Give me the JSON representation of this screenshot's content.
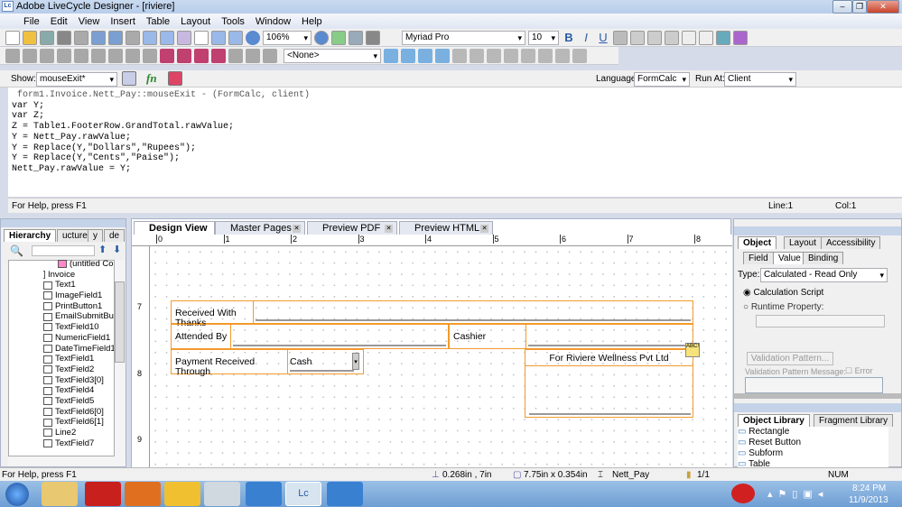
{
  "window": {
    "title": "Adobe LiveCycle Designer - [riviere]",
    "app_icon": "Lc"
  },
  "menu": [
    "File",
    "Edit",
    "View",
    "Insert",
    "Table",
    "Layout",
    "Tools",
    "Window",
    "Help"
  ],
  "toolbar1": {
    "zoom": "106%",
    "font": "Myriad Pro",
    "size": "10",
    "bold": "B",
    "italic": "I",
    "underline": "U"
  },
  "toolbar2": {
    "master_select": "<None>"
  },
  "script": {
    "show_label": "Show:",
    "event": "mouseExit*",
    "fx": "fn",
    "language_label": "Language:",
    "language": "FormCalc",
    "run_at_label": "Run At:",
    "run_at": "Client",
    "lines": [
      " form1.Invoice.Nett_Pay::mouseExit - (FormCalc, client)",
      "var Y;",
      "var Z;",
      "Z = Table1.FooterRow.GrandTotal.rawValue;",
      "Y = Nett_Pay.rawValue;",
      "Y = Replace(Y,\"Dollars\",\"Rupees\");",
      "Y = Replace(Y,\"Cents\",\"Paise\");",
      "Nett_Pay.rawValue = Y;"
    ],
    "help": "For Help, press F1",
    "line": "Line:1",
    "col": "Col:1"
  },
  "hierarchy": {
    "tabs": [
      "Hierarchy",
      "ucture",
      "y",
      "de"
    ],
    "items": [
      "(untitled Cor",
      "Invoice",
      "Text1",
      "ImageField1",
      "PrintButton1",
      "EmailSubmitButt",
      "TextField10",
      "NumericField1",
      "DateTimeField1",
      "TextField1",
      "TextField2",
      "TextField3[0]",
      "TextField4",
      "TextField5",
      "TextField6[0]",
      "TextField6[1]",
      "Line2",
      "TextField7"
    ]
  },
  "tabs": [
    {
      "label": "Design View"
    },
    {
      "label": "Master Pages"
    },
    {
      "label": "Preview PDF"
    },
    {
      "label": "Preview HTML"
    }
  ],
  "ruler": {
    "h": [
      "0",
      "1",
      "2",
      "3",
      "4",
      "5",
      "6",
      "7",
      "8"
    ],
    "v": [
      "7",
      "8",
      "9"
    ]
  },
  "form": {
    "received": "Received With Thanks",
    "attended": "Attended By",
    "cashier": "Cashier",
    "payment": "Payment Received Through",
    "payment_value": "Cash",
    "company": "For Riviere Wellness Pvt Ltd"
  },
  "object_panel": {
    "tabs": [
      "Object",
      "Layout",
      "Accessibility"
    ],
    "subtabs": [
      "Field",
      "Value",
      "Binding"
    ],
    "type_label": "Type:",
    "type": "Calculated - Read Only",
    "calc_script": "Calculation Script",
    "runtime": "Runtime Property:",
    "validation_btn": "Validation Pattern...",
    "validation_msg": "Validation Pattern Message:",
    "error": "Error"
  },
  "library": {
    "tabs": [
      "Object Library",
      "Fragment Library"
    ],
    "items": [
      "Rectangle",
      "Reset Button",
      "Subform",
      "Table"
    ]
  },
  "status": {
    "help": "For Help, press F1",
    "position": "0.268in , 7in",
    "size": "7.75in x 0.354in",
    "object": "Nett_Pay",
    "page": "1/1",
    "num": "NUM"
  },
  "taskbar": {
    "time": "8:24 PM",
    "date": "11/9/2013"
  }
}
